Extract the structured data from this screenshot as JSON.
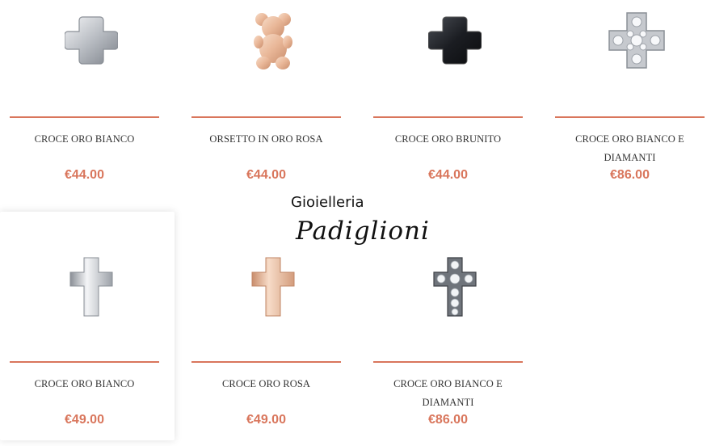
{
  "products": [
    {
      "name": "CROCE ORO BIANCO",
      "price": "€44.00",
      "icon": "white-gold-plus-cross-icon"
    },
    {
      "name": "ORSETTO IN ORO ROSA",
      "price": "€44.00",
      "icon": "rose-gold-teddy-bear-icon"
    },
    {
      "name": "CROCE ORO BRUNITO",
      "price": "€44.00",
      "icon": "burnished-gold-plus-cross-icon"
    },
    {
      "name": "CROCE ORO BIANCO E DIAMANTI",
      "price": "€86.00",
      "icon": "diamond-plus-cross-icon"
    },
    {
      "name": "CROCE ORO BIANCO",
      "price": "€49.00",
      "icon": "white-gold-latin-cross-icon"
    },
    {
      "name": "CROCE ORO ROSA",
      "price": "€49.00",
      "icon": "rose-gold-latin-cross-icon"
    },
    {
      "name": "CROCE ORO BIANCO E DIAMANTI",
      "price": "€86.00",
      "icon": "diamond-latin-cross-icon"
    }
  ],
  "watermark": {
    "line1": "Gioielleria",
    "line2": "Padiglioni"
  },
  "colors": {
    "accent": "#d9765c",
    "text": "#333333"
  }
}
